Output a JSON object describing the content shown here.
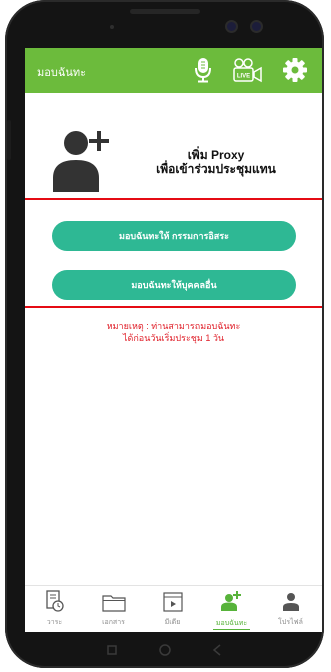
{
  "header": {
    "title": "มอบฉันทะ",
    "icons": [
      "microphone-icon",
      "live-video-icon",
      "gear-icon"
    ]
  },
  "promo": {
    "line1": "เพิ่ม Proxy",
    "line2": "เพื่อเข้าร่วมประชุมแทน",
    "icon": "add-user-icon"
  },
  "buttons": {
    "proxy_director": "มอบฉันทะให้ กรรมการอิสระ",
    "proxy_person": "มอบฉันทะให้บุคคลอื่น"
  },
  "note": {
    "line1": "หมายเหตุ : ท่านสามารถมอบฉันทะ",
    "line2": "ได้ก่อนวันเริ่มประชุม 1 วัน"
  },
  "tabs": [
    {
      "label": "วาระ",
      "icon": "agenda-icon",
      "active": false
    },
    {
      "label": "เอกสาร",
      "icon": "folder-icon",
      "active": false
    },
    {
      "label": "มีเดีย",
      "icon": "media-icon",
      "active": false
    },
    {
      "label": "มอบฉันทะ",
      "icon": "add-user-icon",
      "active": true
    },
    {
      "label": "โปรไฟล์",
      "icon": "person-icon",
      "active": false
    }
  ],
  "colors": {
    "header": "#6cbb3c",
    "button": "#2eb894",
    "highlight": "#e50b14",
    "note": "#e0202a",
    "active_tab": "#57b33a"
  }
}
